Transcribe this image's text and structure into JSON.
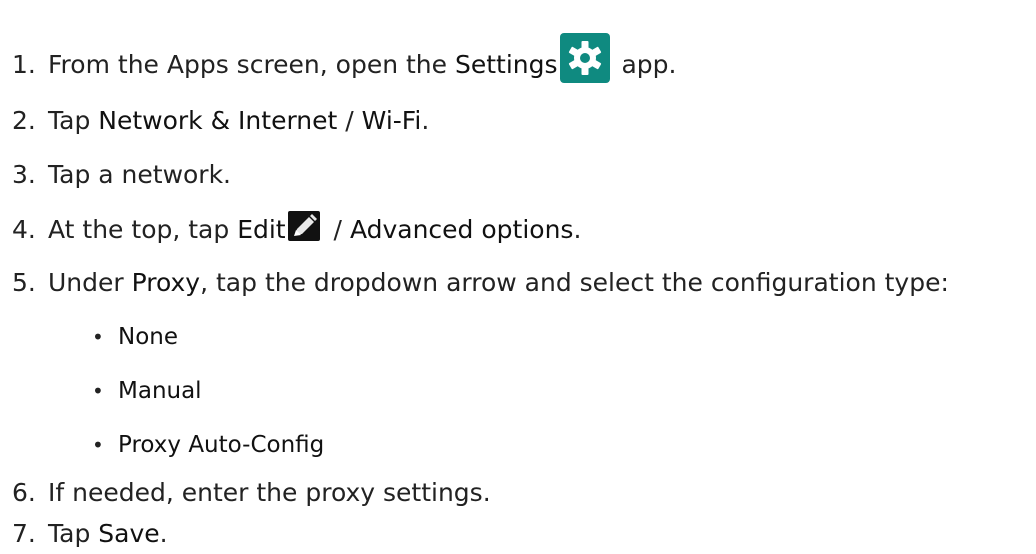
{
  "steps": [
    {
      "number": "1.",
      "text_before": "From the Apps screen, open the ",
      "ui_term": "Settings",
      "text_after": " app.",
      "icon": "settings-gear-icon",
      "icon_color": "#0f8a80"
    },
    {
      "number": "2.",
      "text_before": "Tap ",
      "ui_term_1": "Network & Internet",
      "separator": " / ",
      "ui_term_2": "Wi-Fi",
      "text_after": "."
    },
    {
      "number": "3.",
      "text": "Tap a network."
    },
    {
      "number": "4.",
      "text_before": "At the top, tap ",
      "ui_term_1": "Edit",
      "separator": " / ",
      "ui_term_2": "Advanced options",
      "text_after": ".",
      "icon": "pencil-edit-icon"
    },
    {
      "number": "5.",
      "text_before": "Under ",
      "ui_term": "Proxy",
      "text_after": ", tap the dropdown arrow and select the configuration type:",
      "options": [
        "None",
        "Manual",
        "Proxy Auto-Config"
      ],
      "bullet": "•"
    },
    {
      "number": "6.",
      "text": "If needed, enter the proxy settings."
    },
    {
      "number": "7.",
      "text_before": "Tap ",
      "ui_term": "Save",
      "text_after": "."
    }
  ]
}
